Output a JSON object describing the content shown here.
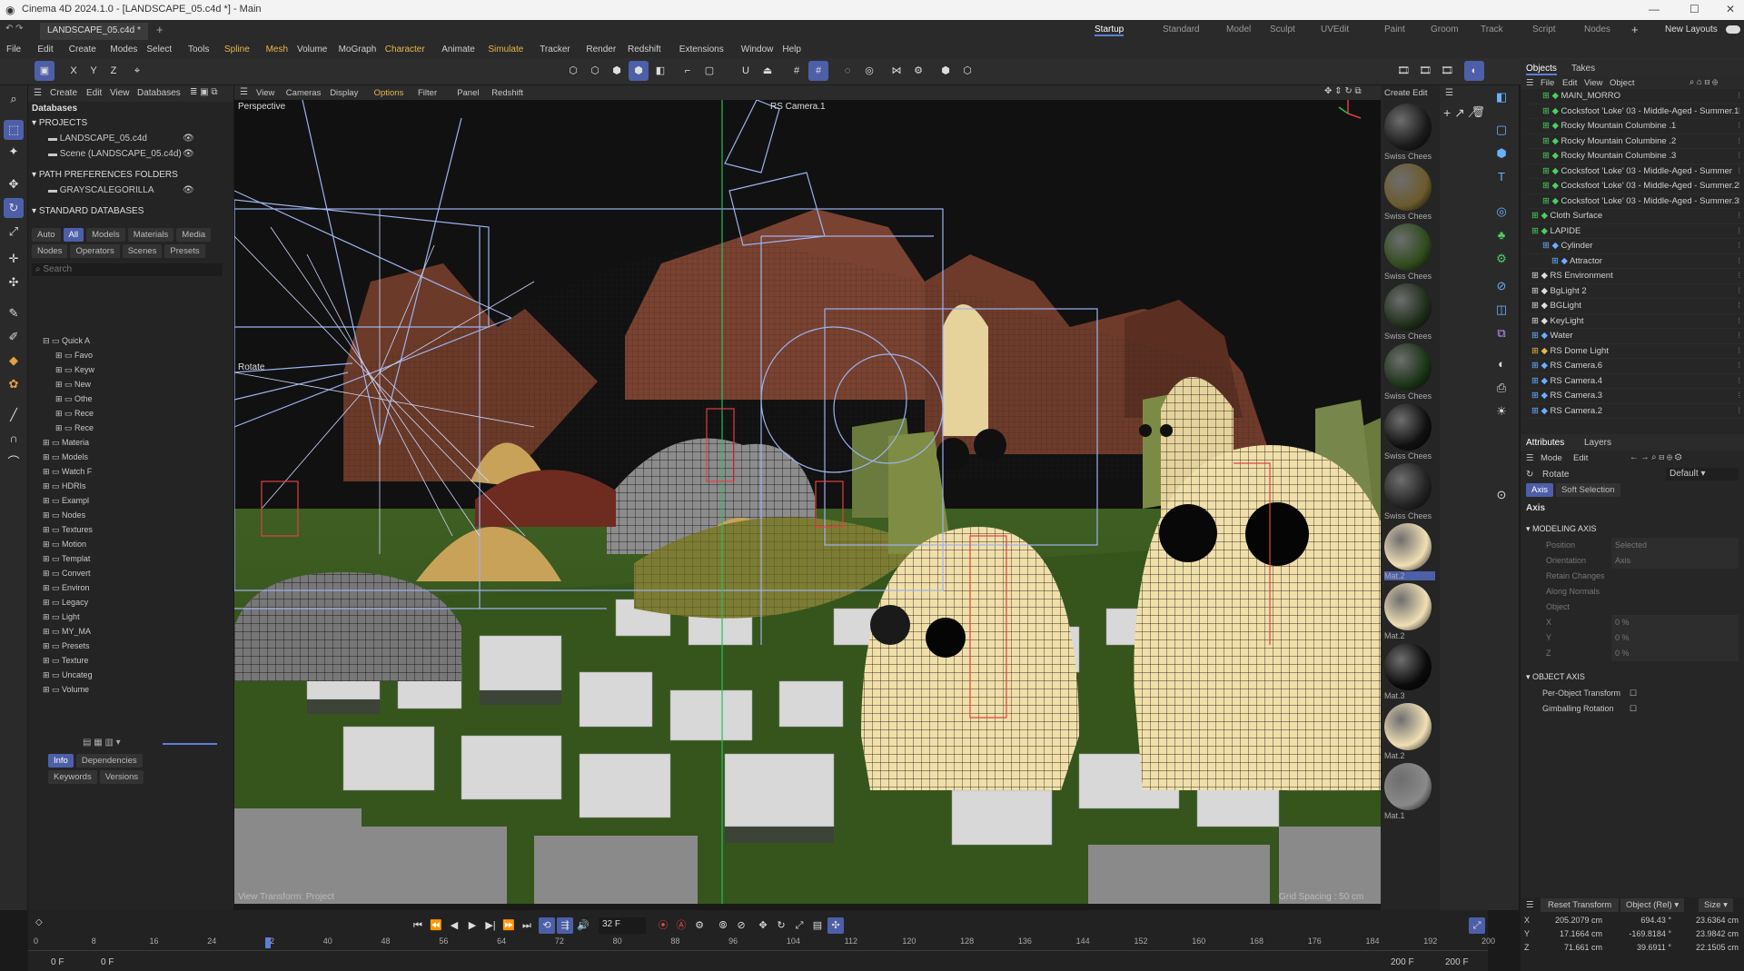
{
  "title_bar": {
    "title": "Cinema 4D 2024.1.0 - [LANDSCAPE_05.c4d *] - Main"
  },
  "tab_bar": {
    "doc_tab": "LANDSCAPE_05.c4d *",
    "layouts": [
      "Startup",
      "Standard",
      "Model",
      "Sculpt",
      "UVEdit",
      "Paint",
      "Groom",
      "Track",
      "Script",
      "Nodes"
    ],
    "new_layouts": "New Layouts"
  },
  "menu": [
    "File",
    "Edit",
    "Create",
    "Modes",
    "Select",
    "Tools",
    "Spline",
    "Mesh",
    "Volume",
    "MoGraph",
    "Character",
    "Animate",
    "Simulate",
    "Tracker",
    "Render",
    "Redshift",
    "Extensions",
    "Window",
    "Help"
  ],
  "axis_buttons": [
    "X",
    "Y",
    "Z"
  ],
  "asset_browser": {
    "menu": [
      "Create",
      "Edit",
      "View",
      "Databases"
    ],
    "title": "Databases",
    "projects_header": "PROJECTS",
    "projects": [
      "LANDSCAPE_05.c4d",
      "Scene (LANDSCAPE_05.c4d)"
    ],
    "path_header": "PATH PREFERENCES FOLDERS",
    "paths": [
      "GRAYSCALEGORILLA"
    ],
    "standard_header": "STANDARD DATABASES",
    "filters_row1": [
      "Auto",
      "All",
      "Models",
      "Materials",
      "Media"
    ],
    "filters_row2": [
      "Nodes",
      "Operators",
      "Scenes",
      "Presets"
    ],
    "search_placeholder": "Search",
    "tree": [
      "Quick A",
      "Favo",
      "Keyw",
      "New",
      "Othe",
      "Rece",
      "Rece",
      "Materia",
      "Models",
      "Watch F",
      "HDRIs",
      "Exampl",
      "Nodes",
      "Textures",
      "Motion",
      "Templat",
      "Convert",
      "Environ",
      "Legacy",
      "Light",
      "MY_MA",
      "Presets",
      "Texture",
      "Uncateg",
      "Volume"
    ],
    "info_tabs": [
      "Info",
      "Dependencies"
    ],
    "info_tabs2": [
      "Keywords",
      "Versions"
    ]
  },
  "viewport": {
    "menu": [
      "View",
      "Cameras",
      "Display",
      "Options",
      "Filter",
      "Panel",
      "Redshift"
    ],
    "label": "Perspective",
    "camera": "RS Camera.1",
    "tool_label": "Rotate",
    "footer_left": "View Transform: Project",
    "footer_right": "Grid Spacing : 50 cm"
  },
  "material_manager": {
    "menu": [
      "Create",
      "Edit"
    ],
    "materials": [
      {
        "label": "Swiss Chees",
        "color": "#1a1a1a"
      },
      {
        "label": "Swiss Chees",
        "color": "#6b5a2c"
      },
      {
        "label": "Swiss Chees",
        "color": "#2f4a1c"
      },
      {
        "label": "Swiss Chees",
        "color": "#1e2d1a"
      },
      {
        "label": "Swiss Chees",
        "color": "#1b3317"
      },
      {
        "label": "Swiss Chees",
        "color": "#101010"
      },
      {
        "label": "Swiss Chees",
        "color": "#222"
      },
      {
        "label": "Mat.2",
        "color": "#f0dfb5"
      },
      {
        "label": "Mat.2",
        "color": "#f0dfb5"
      },
      {
        "label": "Mat.3",
        "color": "#0a0a0a"
      },
      {
        "label": "Mat.2",
        "color": "#f0dfb5"
      },
      {
        "label": "Mat.1",
        "color": "#8a8a8a"
      }
    ]
  },
  "objects_panel": {
    "tabs": [
      "Objects",
      "Takes"
    ],
    "menu": [
      "File",
      "Edit",
      "View",
      "Object"
    ],
    "items": [
      "MAIN_MORRO",
      "Cocksfoot 'Loke' 03 - Middle-Aged - Summer.1",
      "Rocky Mountain Columbine .1",
      "Rocky Mountain Columbine .2",
      "Rocky Mountain Columbine .3",
      "Cocksfoot 'Loke' 03 - Middle-Aged - Summer",
      "Cocksfoot 'Loke' 03 - Middle-Aged - Summer.2",
      "Cocksfoot 'Loke' 03 - Middle-Aged - Summer.3",
      "Cloth Surface",
      "LAPIDE",
      "Cylinder",
      "Attractor",
      "RS Environment",
      "BgLight 2",
      "BGLight",
      "KeyLight",
      "Water",
      "RS Dome Light",
      "RS Camera.6",
      "RS Camera.4",
      "RS Camera.3",
      "RS Camera.2"
    ]
  },
  "attributes_panel": {
    "tabs": [
      "Attributes",
      "Layers"
    ],
    "menu": [
      "Mode",
      "Edit"
    ],
    "object": "Rotate",
    "preset": "Default",
    "subtabs": [
      "Axis",
      "Soft Selection"
    ],
    "section": "Axis",
    "modeling_axis": "MODELING AXIS",
    "fields": [
      {
        "label": "Position",
        "value": "Selected"
      },
      {
        "label": "Orientation",
        "value": "Axis"
      },
      {
        "label": "Retain Changes",
        "value": ""
      },
      {
        "label": "Along Normals",
        "value": ""
      },
      {
        "label": "Object",
        "value": ""
      },
      {
        "label": "X",
        "value": "0 %"
      },
      {
        "label": "Y",
        "value": "0 %"
      },
      {
        "label": "Z",
        "value": "0 %"
      }
    ],
    "object_axis": "OBJECT AXIS",
    "checks": [
      "Per-Object Transform",
      "Gimballing Rotation"
    ]
  },
  "coordinates": {
    "reset_label": "Reset Transform",
    "mode": "Object (Rel)",
    "size_mode": "Size",
    "rows": [
      {
        "axis": "X",
        "pos": "205.2079 cm",
        "rot": "694.43 °",
        "size": "23.6364 cm"
      },
      {
        "axis": "Y",
        "pos": "17.1664 cm",
        "rot": "-169.8184 °",
        "size": "23.9842 cm"
      },
      {
        "axis": "Z",
        "pos": "71.661 cm",
        "rot": "39.6911 °",
        "size": "22.1505 cm"
      }
    ]
  },
  "timeline": {
    "current_frame": "32 F",
    "ticks": [
      "0",
      "8",
      "16",
      "24",
      "32",
      "40",
      "48",
      "56",
      "64",
      "72",
      "80",
      "88",
      "96",
      "104",
      "112",
      "120",
      "128",
      "136",
      "144",
      "152",
      "160",
      "168",
      "176",
      "184",
      "192",
      "200"
    ],
    "start": "0 F",
    "start2": "0 F",
    "end": "200 F",
    "end2": "200 F",
    "current_fraction": 0.16
  }
}
